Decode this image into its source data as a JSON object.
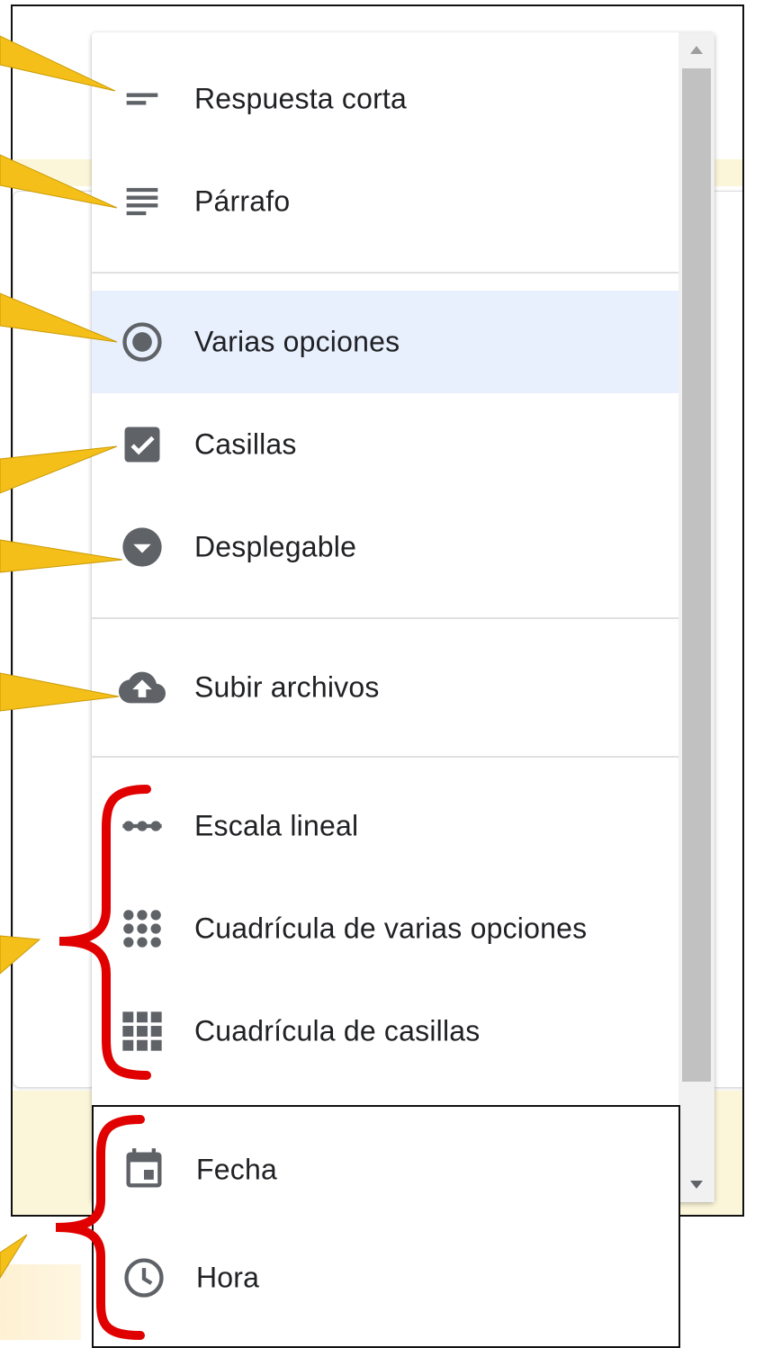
{
  "menu": {
    "items": [
      {
        "label": "Respuesta corta",
        "icon": "short-text-icon"
      },
      {
        "label": "Párrafo",
        "icon": "paragraph-icon"
      },
      {
        "label": "Varias opciones",
        "icon": "radio-button-icon",
        "selected": true
      },
      {
        "label": "Casillas",
        "icon": "checkbox-icon"
      },
      {
        "label": "Desplegable",
        "icon": "dropdown-icon"
      },
      {
        "label": "Subir archivos",
        "icon": "cloud-upload-icon"
      },
      {
        "label": "Escala lineal",
        "icon": "linear-scale-icon"
      },
      {
        "label": "Cuadrícula de varias opciones",
        "icon": "radio-grid-icon"
      },
      {
        "label": "Cuadrícula de casillas",
        "icon": "checkbox-grid-icon"
      }
    ]
  },
  "bottom_panel": {
    "items": [
      {
        "label": "Fecha",
        "icon": "calendar-icon"
      },
      {
        "label": "Hora",
        "icon": "clock-icon"
      }
    ]
  },
  "colors": {
    "icon": "#5f6368",
    "text": "#202124",
    "selected_background": "#e8f0fe",
    "callout": "#f5bf1a",
    "bracket": "#e00000",
    "page_band": "#fbf6d9"
  }
}
